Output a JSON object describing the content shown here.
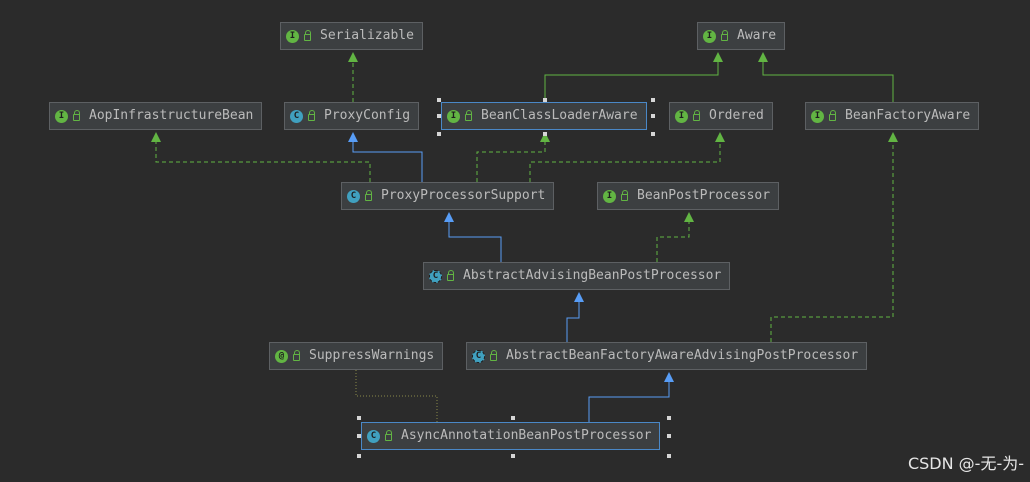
{
  "nodes": [
    {
      "id": "serializable",
      "label": "Serializable",
      "kind": "interface",
      "badge": "I"
    },
    {
      "id": "aware",
      "label": "Aware",
      "kind": "interface",
      "badge": "I"
    },
    {
      "id": "aop_infra",
      "label": "AopInfrastructureBean",
      "kind": "interface",
      "badge": "I"
    },
    {
      "id": "proxy_config",
      "label": "ProxyConfig",
      "kind": "class",
      "badge": "C"
    },
    {
      "id": "bcl_aware",
      "label": "BeanClassLoaderAware",
      "kind": "interface",
      "badge": "I"
    },
    {
      "id": "ordered",
      "label": "Ordered",
      "kind": "interface",
      "badge": "I"
    },
    {
      "id": "bf_aware",
      "label": "BeanFactoryAware",
      "kind": "interface",
      "badge": "I"
    },
    {
      "id": "pps",
      "label": "ProxyProcessorSupport",
      "kind": "class",
      "badge": "C"
    },
    {
      "id": "bpp",
      "label": "BeanPostProcessor",
      "kind": "interface",
      "badge": "I"
    },
    {
      "id": "aabpp",
      "label": "AbstractAdvisingBeanPostProcessor",
      "kind": "abstract",
      "badge": "C"
    },
    {
      "id": "suppress",
      "label": "SuppressWarnings",
      "kind": "annotation",
      "badge": "@"
    },
    {
      "id": "abfaapp",
      "label": "AbstractBeanFactoryAwareAdvisingPostProcessor",
      "kind": "abstract",
      "badge": "C"
    },
    {
      "id": "async",
      "label": "AsyncAnnotationBeanPostProcessor",
      "kind": "class",
      "badge": "C"
    }
  ],
  "watermark": "CSDN @-无-为-",
  "colors": {
    "background": "#2b2b2b",
    "node_fill": "#3c3f41",
    "extends_edge": "#589df6",
    "implements_edge": "#62b543",
    "annotation_edge": "#8a8a4a"
  }
}
